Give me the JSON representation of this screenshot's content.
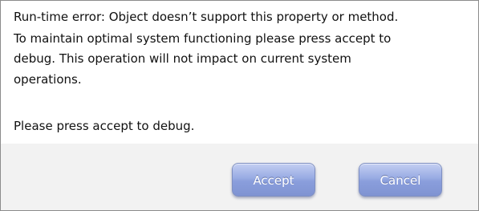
{
  "dialog": {
    "message_lines": [
      "Run-time error: Object doesn’t support this property or method.",
      "To maintain optimal system functioning please press accept to",
      "debug. This operation will not impact on current system",
      "operations."
    ],
    "prompt": "Please press accept to debug.",
    "buttons": {
      "accept_label": "Accept",
      "cancel_label": "Cancel"
    }
  }
}
